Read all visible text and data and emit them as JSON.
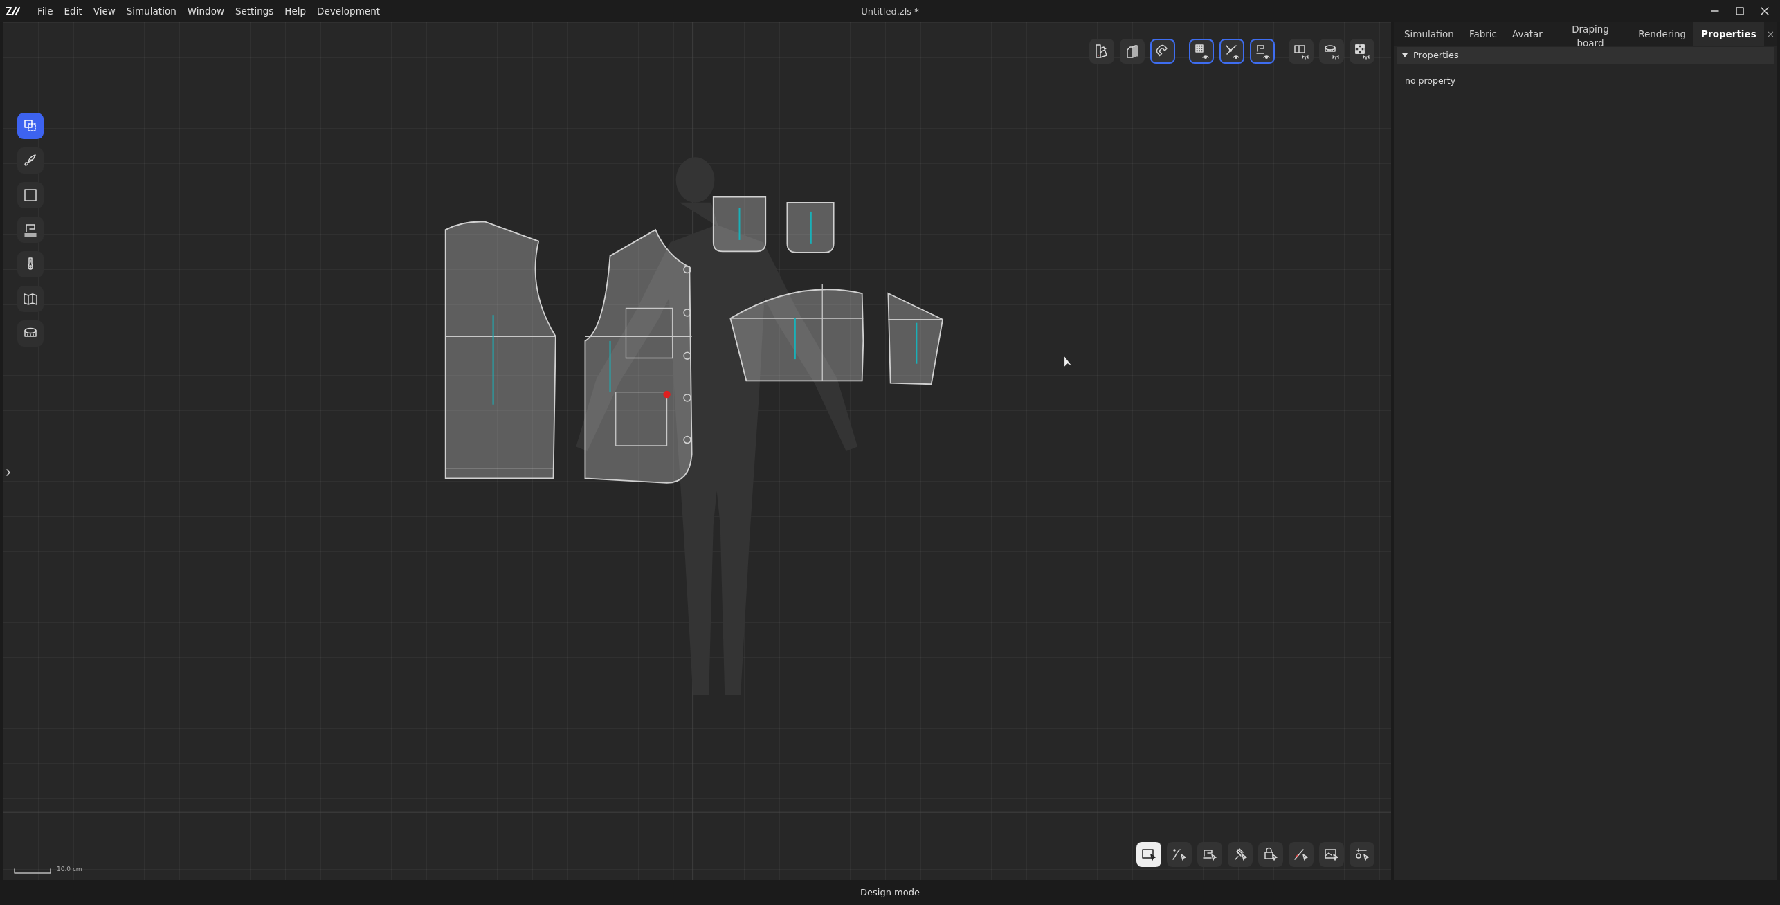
{
  "menu": [
    "File",
    "Edit",
    "View",
    "Simulation",
    "Window",
    "Settings",
    "Help",
    "Development"
  ],
  "window": {
    "title": "Untitled.zls *"
  },
  "top_toolbar": [
    {
      "selected": false
    },
    {
      "selected": false
    },
    {
      "selected": true
    },
    {
      "selected": true
    },
    {
      "selected": true
    },
    {
      "selected": true
    },
    {
      "selected": false
    },
    {
      "selected": false
    },
    {
      "selected": false
    }
  ],
  "left_toolbar": [
    {
      "selected": true
    },
    {
      "selected": false
    },
    {
      "selected": false
    },
    {
      "selected": false
    },
    {
      "selected": false
    },
    {
      "selected": false
    },
    {
      "selected": false
    }
  ],
  "bottom_toolbar": [
    {
      "selected": true
    },
    {
      "selected": false
    },
    {
      "selected": false
    },
    {
      "selected": false
    },
    {
      "selected": false
    },
    {
      "selected": false
    },
    {
      "selected": false
    },
    {
      "selected": false
    }
  ],
  "scale": "10.0 cm",
  "panel": {
    "tabs": [
      {
        "label": "Simulation",
        "selected": false
      },
      {
        "label": "Fabric",
        "selected": false
      },
      {
        "label": "Avatar",
        "selected": false
      },
      {
        "label": "Draping board",
        "selected": false
      },
      {
        "label": "Rendering",
        "selected": false
      },
      {
        "label": "Properties",
        "selected": true
      }
    ],
    "tab_close": "×",
    "section": {
      "title": "Properties",
      "expanded": true,
      "content": "no property"
    }
  },
  "status_bar": "Design mode"
}
